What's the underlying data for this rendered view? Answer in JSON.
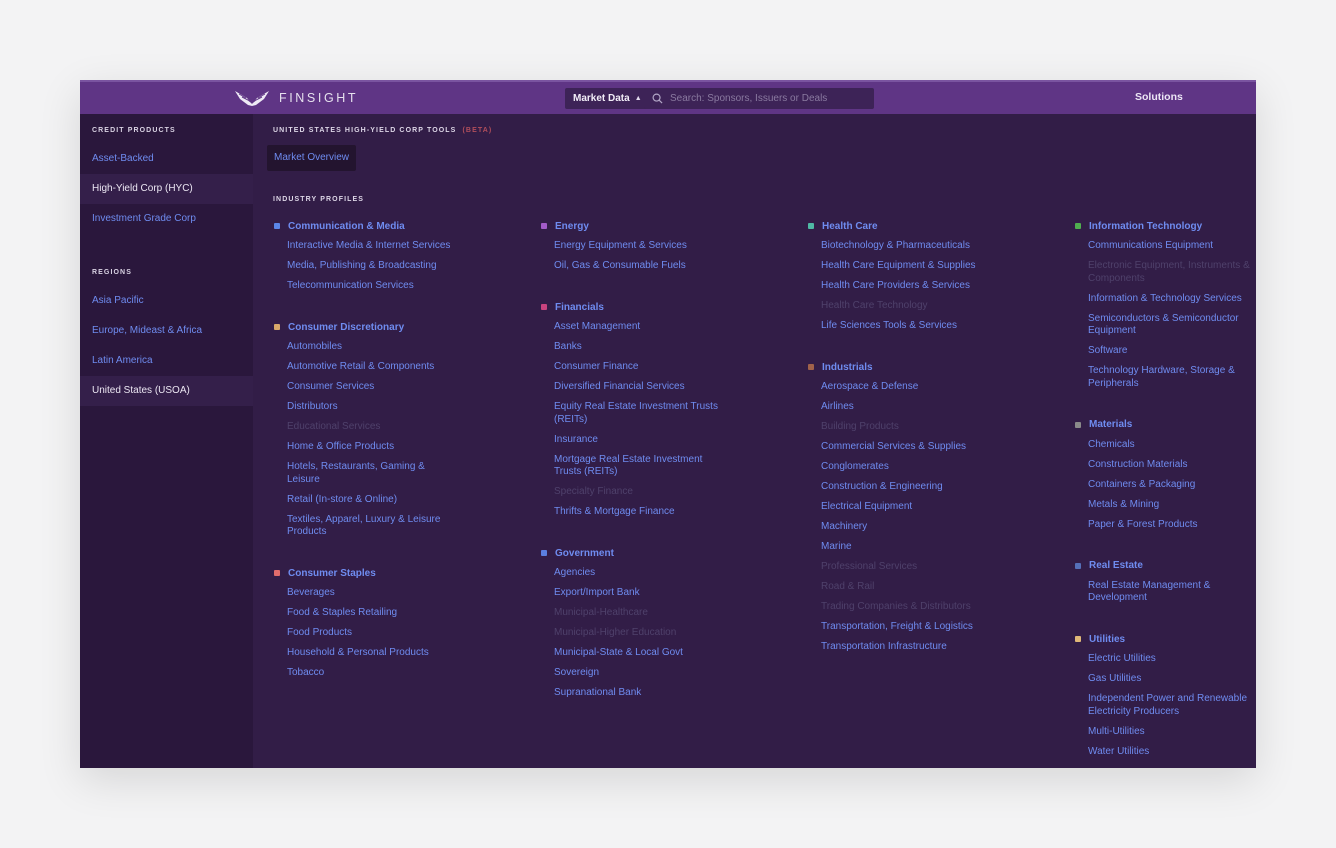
{
  "header": {
    "brand": "FINSIGHT",
    "market_data_label": "Market Data",
    "market_data_caret": "▲",
    "search_placeholder": "Search: Sponsors, Issuers or Deals",
    "search_value": "",
    "solutions_label": "Solutions"
  },
  "colors": {
    "header_bg": "#5f3585",
    "sidebar_bg": "#2a173c",
    "main_bg": "#321d47",
    "link": "#6f8cf0",
    "link_disabled": "#4f416b",
    "beta": "#b14e5b"
  },
  "sidebar": {
    "credit_heading": "CREDIT PRODUCTS",
    "credit_items": [
      {
        "label": "Asset-Backed",
        "active": false
      },
      {
        "label": "High-Yield Corp (HYC)",
        "active": true
      },
      {
        "label": "Investment Grade Corp",
        "active": false
      }
    ],
    "regions_heading": "REGIONS",
    "region_items": [
      {
        "label": "Asia Pacific",
        "active": false
      },
      {
        "label": "Europe, Mideast & Africa",
        "active": false
      },
      {
        "label": "Latin America",
        "active": false
      },
      {
        "label": "United States (USOA)",
        "active": true
      }
    ]
  },
  "main": {
    "tools_heading": "UNITED STATES HIGH-YIELD CORP TOOLS",
    "beta_label": "(BETA)",
    "market_overview_label": "Market Overview",
    "profiles_heading": "INDUSTRY PROFILES",
    "columns": [
      [
        {
          "title": "Communication & Media",
          "color": "#5b86e8",
          "items": [
            {
              "label": "Interactive Media & Internet Services",
              "disabled": false
            },
            {
              "label": "Media, Publishing & Broadcasting",
              "disabled": false
            },
            {
              "label": "Telecommunication Services",
              "disabled": false
            }
          ]
        },
        {
          "title": "Consumer Discretionary",
          "color": "#d9a86a",
          "items": [
            {
              "label": "Automobiles",
              "disabled": false
            },
            {
              "label": "Automotive Retail & Components",
              "disabled": false
            },
            {
              "label": "Consumer Services",
              "disabled": false
            },
            {
              "label": "Distributors",
              "disabled": false
            },
            {
              "label": "Educational Services",
              "disabled": true
            },
            {
              "label": "Home & Office Products",
              "disabled": false
            },
            {
              "label": "Hotels, Restaurants, Gaming & Leisure",
              "disabled": false
            },
            {
              "label": "Retail (In-store & Online)",
              "disabled": false
            },
            {
              "label": "Textiles, Apparel, Luxury & Leisure Products",
              "disabled": false
            }
          ]
        },
        {
          "title": "Consumer Staples",
          "color": "#e06c6c",
          "items": [
            {
              "label": "Beverages",
              "disabled": false
            },
            {
              "label": "Food & Staples Retailing",
              "disabled": false
            },
            {
              "label": "Food Products",
              "disabled": false
            },
            {
              "label": "Household & Personal Products",
              "disabled": false
            },
            {
              "label": "Tobacco",
              "disabled": false
            }
          ]
        }
      ],
      [
        {
          "title": "Energy",
          "color": "#a35bc9",
          "items": [
            {
              "label": "Energy Equipment & Services",
              "disabled": false
            },
            {
              "label": "Oil, Gas & Consumable Fuels",
              "disabled": false
            }
          ]
        },
        {
          "title": "Financials",
          "color": "#c9437f",
          "items": [
            {
              "label": "Asset Management",
              "disabled": false
            },
            {
              "label": "Banks",
              "disabled": false
            },
            {
              "label": "Consumer Finance",
              "disabled": false
            },
            {
              "label": "Diversified Financial Services",
              "disabled": false
            },
            {
              "label": "Equity Real Estate Investment Trusts (REITs)",
              "disabled": false
            },
            {
              "label": "Insurance",
              "disabled": false
            },
            {
              "label": "Mortgage Real Estate Investment Trusts (REITs)",
              "disabled": false
            },
            {
              "label": "Specialty Finance",
              "disabled": true
            },
            {
              "label": "Thrifts & Mortgage Finance",
              "disabled": false
            }
          ]
        },
        {
          "title": "Government",
          "color": "#5b7fe0",
          "items": [
            {
              "label": "Agencies",
              "disabled": false
            },
            {
              "label": "Export/Import Bank",
              "disabled": false
            },
            {
              "label": "Municipal-Healthcare",
              "disabled": true
            },
            {
              "label": "Municipal-Higher Education",
              "disabled": true
            },
            {
              "label": "Municipal-State & Local Govt",
              "disabled": false
            },
            {
              "label": "Sovereign",
              "disabled": false
            },
            {
              "label": "Supranational Bank",
              "disabled": false
            }
          ]
        }
      ],
      [
        {
          "title": "Health Care",
          "color": "#4fb8a4",
          "items": [
            {
              "label": "Biotechnology & Pharmaceuticals",
              "disabled": false
            },
            {
              "label": "Health Care Equipment & Supplies",
              "disabled": false
            },
            {
              "label": "Health Care Providers & Services",
              "disabled": false
            },
            {
              "label": "Health Care Technology",
              "disabled": true
            },
            {
              "label": "Life Sciences Tools & Services",
              "disabled": false
            }
          ]
        },
        {
          "title": "Industrials",
          "color": "#a0624a",
          "items": [
            {
              "label": "Aerospace & Defense",
              "disabled": false
            },
            {
              "label": "Airlines",
              "disabled": false
            },
            {
              "label": "Building Products",
              "disabled": true
            },
            {
              "label": "Commercial Services & Supplies",
              "disabled": false
            },
            {
              "label": "Conglomerates",
              "disabled": false
            },
            {
              "label": "Construction & Engineering",
              "disabled": false
            },
            {
              "label": "Electrical Equipment",
              "disabled": false
            },
            {
              "label": "Machinery",
              "disabled": false
            },
            {
              "label": "Marine",
              "disabled": false
            },
            {
              "label": "Professional Services",
              "disabled": true
            },
            {
              "label": "Road & Rail",
              "disabled": true
            },
            {
              "label": "Trading Companies & Distributors",
              "disabled": true
            },
            {
              "label": "Transportation, Freight & Logistics",
              "disabled": false
            },
            {
              "label": "Transportation Infrastructure",
              "disabled": false
            }
          ]
        }
      ],
      [
        {
          "title": "Information Technology",
          "color": "#4fae4f",
          "items": [
            {
              "label": "Communications Equipment",
              "disabled": false
            },
            {
              "label": "Electronic Equipment, Instruments & Components",
              "disabled": true
            },
            {
              "label": "Information & Technology Services",
              "disabled": false
            },
            {
              "label": "Semiconductors & Semiconductor Equipment",
              "disabled": false
            },
            {
              "label": "Software",
              "disabled": false
            },
            {
              "label": "Technology Hardware, Storage & Peripherals",
              "disabled": false
            }
          ]
        },
        {
          "title": "Materials",
          "color": "#8a8a8a",
          "items": [
            {
              "label": "Chemicals",
              "disabled": false
            },
            {
              "label": "Construction Materials",
              "disabled": false
            },
            {
              "label": "Containers & Packaging",
              "disabled": false
            },
            {
              "label": "Metals & Mining",
              "disabled": false
            },
            {
              "label": "Paper & Forest Products",
              "disabled": false
            }
          ]
        },
        {
          "title": "Real Estate",
          "color": "#5570b8",
          "items": [
            {
              "label": "Real Estate Management & Development",
              "disabled": false
            }
          ]
        },
        {
          "title": "Utilities",
          "color": "#e0b878",
          "items": [
            {
              "label": "Electric Utilities",
              "disabled": false
            },
            {
              "label": "Gas Utilities",
              "disabled": false
            },
            {
              "label": "Independent Power and Renewable Electricity Producers",
              "disabled": false
            },
            {
              "label": "Multi-Utilities",
              "disabled": false
            },
            {
              "label": "Water Utilities",
              "disabled": false
            }
          ]
        }
      ]
    ]
  }
}
